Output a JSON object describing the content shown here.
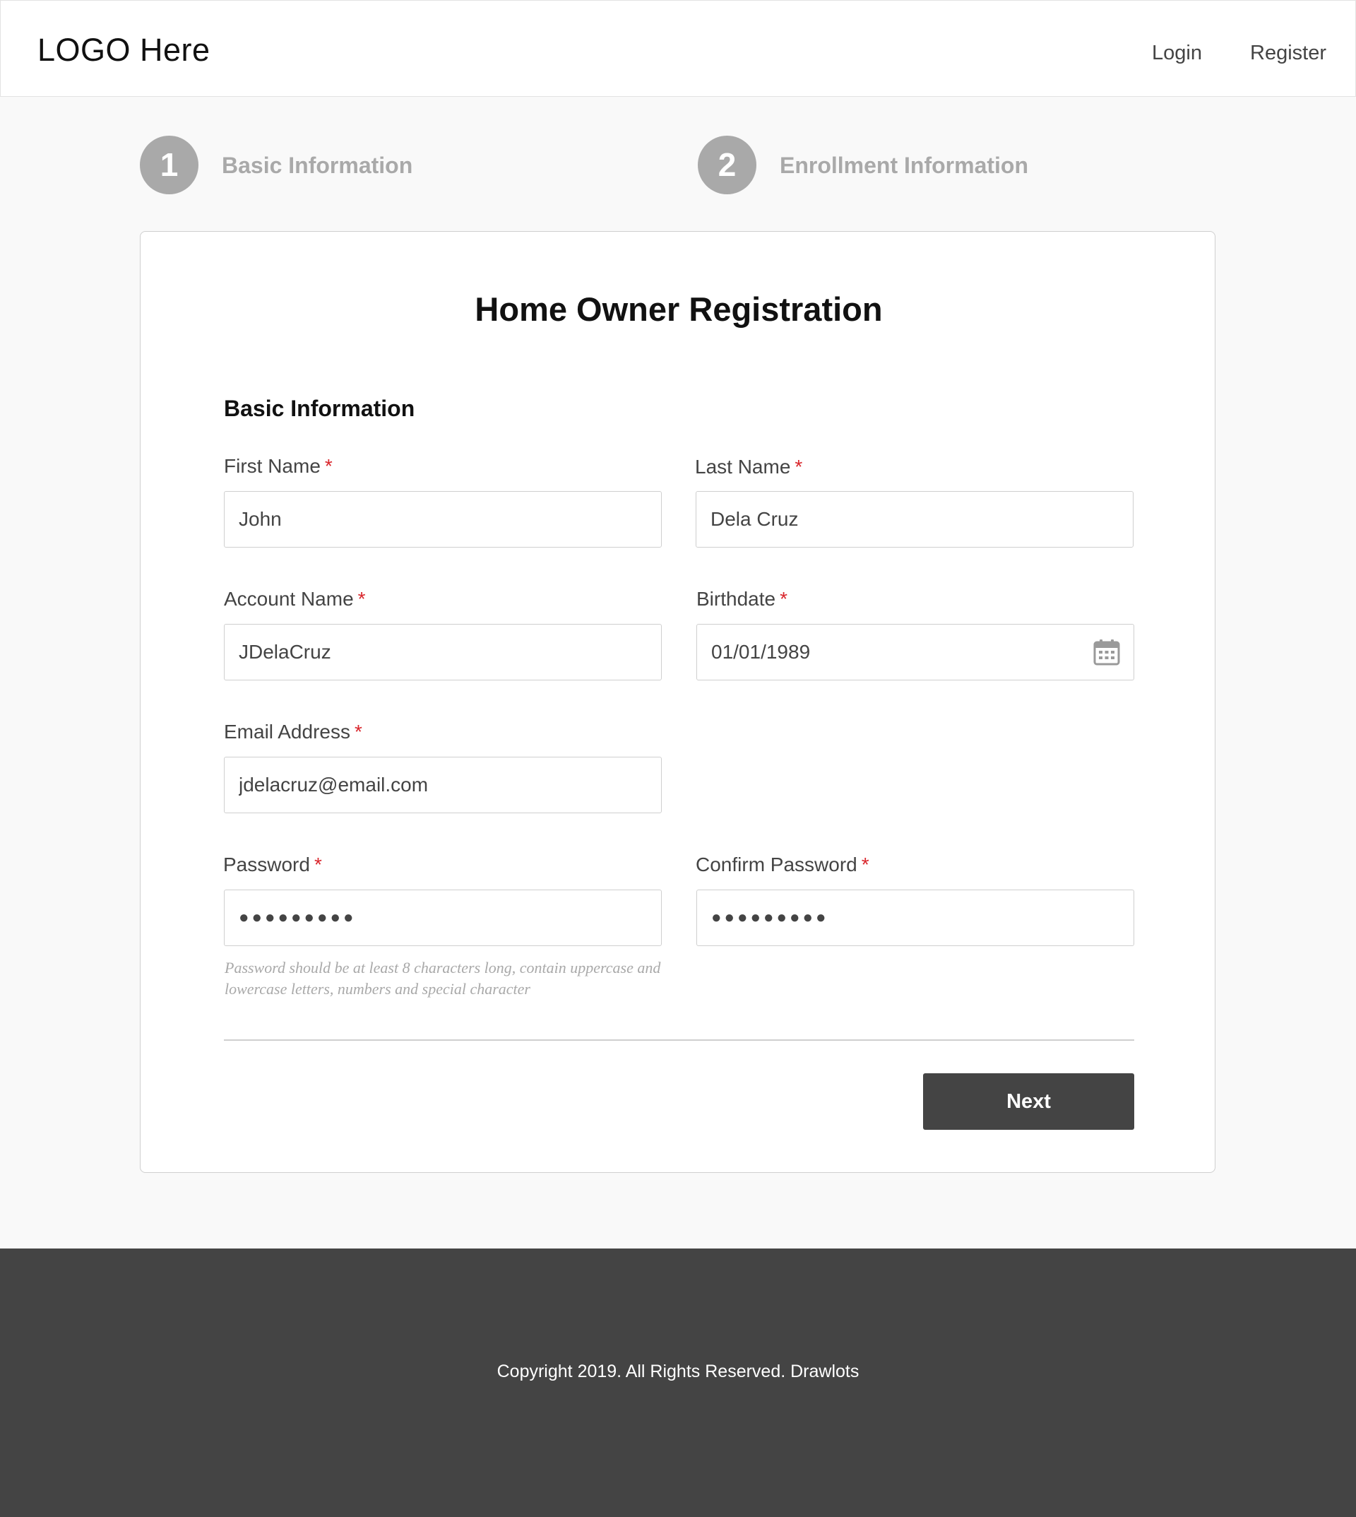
{
  "header": {
    "logo": "LOGO Here",
    "nav": {
      "login": "Login",
      "register": "Register"
    }
  },
  "stepper": {
    "steps": [
      {
        "number": "1",
        "label": "Basic Information"
      },
      {
        "number": "2",
        "label": "Enrollment Information"
      }
    ]
  },
  "form": {
    "title": "Home Owner Registration",
    "section_title": "Basic Information",
    "required_marker": "*",
    "fields": {
      "first_name": {
        "label": "First Name",
        "value": "John"
      },
      "last_name": {
        "label": "Last Name",
        "value": "Dela Cruz"
      },
      "account_name": {
        "label": "Account Name",
        "value": "JDelaCruz"
      },
      "birthdate": {
        "label": "Birthdate",
        "value": "01/01/1989",
        "icon": "calendar-icon"
      },
      "email": {
        "label": "Email Address",
        "value": "jdelacruz@email.com"
      },
      "password": {
        "label": "Password",
        "value": "●●●●●●●●●"
      },
      "confirm_password": {
        "label": "Confirm Password",
        "value": "●●●●●●●●●"
      }
    },
    "password_help": "Password should be at least 8 characters long, contain uppercase and lowercase letters, numbers and special character",
    "next_label": "Next"
  },
  "footer": {
    "copyright": "Copyright 2019. All Rights Reserved. Drawlots"
  },
  "colors": {
    "accent_dark": "#444444",
    "step_gray": "#a9a9a9",
    "required_red": "#d9262c",
    "page_bg": "#f9f9f9"
  }
}
